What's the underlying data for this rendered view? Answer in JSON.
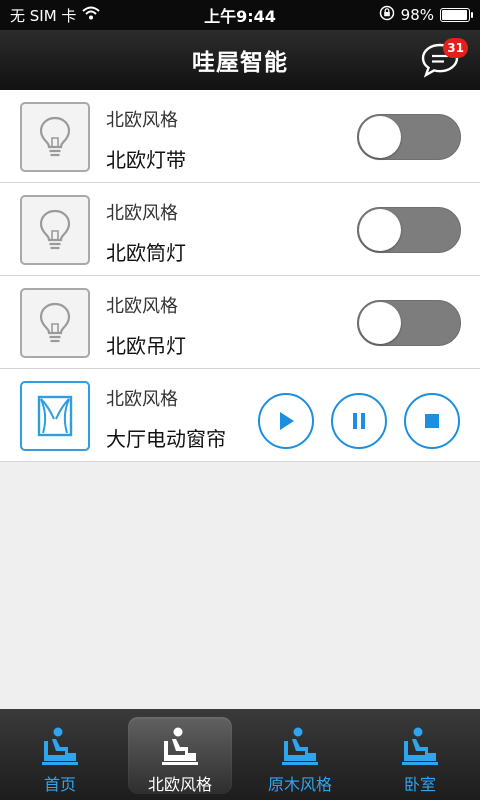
{
  "status": {
    "carrier": "无 SIM 卡",
    "time": "上午9:44",
    "battery": "98%",
    "battery_level": 0.98
  },
  "header": {
    "title": "哇屋智能",
    "badge_count": "31"
  },
  "devices": [
    {
      "style": "北欧风格",
      "name": "北欧灯带",
      "icon": "lightbulb-icon",
      "type": "toggle",
      "on": false
    },
    {
      "style": "北欧风格",
      "name": "北欧筒灯",
      "icon": "lightbulb-icon",
      "type": "toggle",
      "on": false
    },
    {
      "style": "北欧风格",
      "name": "北欧吊灯",
      "icon": "lightbulb-icon",
      "type": "toggle",
      "on": false
    },
    {
      "style": "北欧风格",
      "name": "大厅电动窗帘",
      "icon": "curtain-icon",
      "type": "curtain",
      "controls": [
        "play-icon",
        "pause-icon",
        "stop-icon"
      ]
    }
  ],
  "tabs": [
    {
      "label": "首页",
      "icon": "chair-icon",
      "active": false
    },
    {
      "label": "北欧风格",
      "icon": "chair-icon",
      "active": true
    },
    {
      "label": "原木风格",
      "icon": "chair-icon",
      "active": false
    },
    {
      "label": "卧室",
      "icon": "chair-icon",
      "active": false
    }
  ],
  "colors": {
    "accent": "#1c8fe0",
    "tab_text": "#2fa5f0",
    "badge": "#e5201a",
    "toggle_off": "#7d7d7d"
  }
}
